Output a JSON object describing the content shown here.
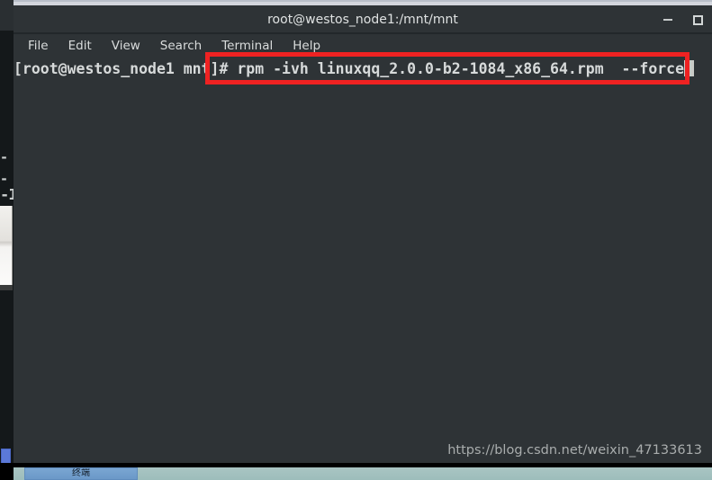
{
  "window": {
    "title": "root@westos_node1:/mnt/mnt",
    "controls": {
      "minimize_label": "–",
      "minimize_name": "minimize-icon",
      "maximize_label": "□",
      "maximize_name": "maximize-icon"
    }
  },
  "menubar": {
    "items": [
      {
        "label": "File"
      },
      {
        "label": "Edit"
      },
      {
        "label": "View"
      },
      {
        "label": "Search"
      },
      {
        "label": "Terminal"
      },
      {
        "label": "Help"
      }
    ]
  },
  "terminal": {
    "prompt": "[root@westos_node1 mnt]# ",
    "command": "rpm -ivh linuxqq_2.0.0-b2-1084_x86_64.rpm  --force",
    "full_line": "[root@westos_node1 mnt]# rpm -ivh linuxqq_2.0.0-b2-1084_x86_64.rpm  --force",
    "cursor": "block",
    "background_color": "#2e3336",
    "foreground_color": "#d7dada"
  },
  "annotation": {
    "shape": "rectangle",
    "color": "#ef2222",
    "highlights": "rpm -ivh linuxqq_2.0.0-b2-1084_x86_64.rpm  --force"
  },
  "watermark": {
    "text": "https://blog.csdn.net/weixin_47133613"
  },
  "background": {
    "left_fragments": [
      {
        "text": "-"
      },
      {
        "text": "-"
      },
      {
        "text": "-1"
      }
    ]
  },
  "taskbar": {
    "task_label": "终端"
  }
}
